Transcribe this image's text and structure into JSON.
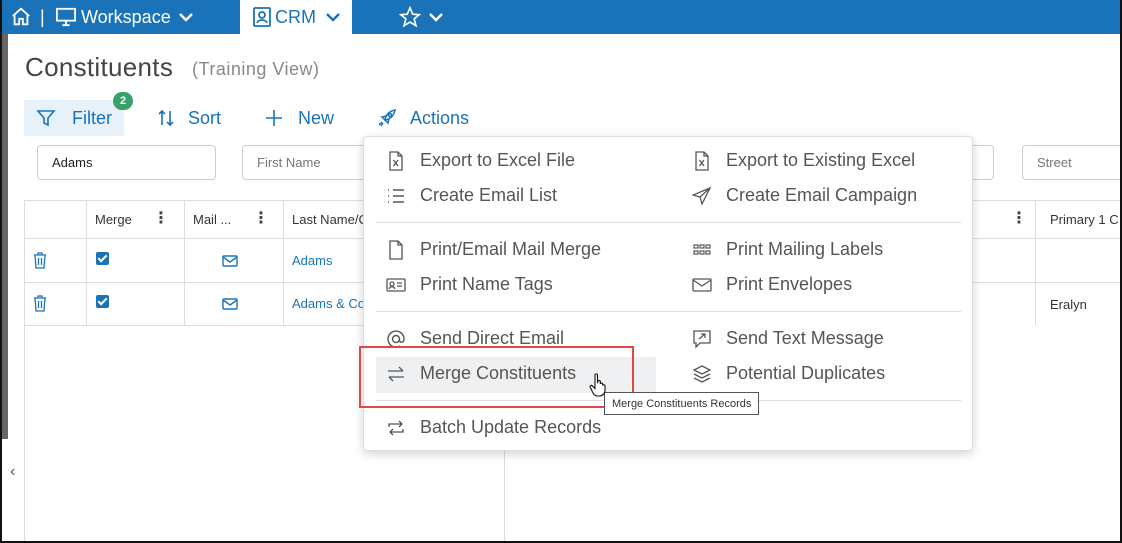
{
  "nav": {
    "separator": "|",
    "workspace_label": "Workspace",
    "crm_label": "CRM"
  },
  "page": {
    "title": "Constituents",
    "subtitle": "(Training View)"
  },
  "toolbar": {
    "filter_label": "Filter",
    "filter_badge": "2",
    "sort_label": "Sort",
    "new_label": "New",
    "actions_label": "Actions"
  },
  "search": {
    "last_name_value": "Adams",
    "first_name_placeholder": "First Name",
    "street_placeholder": "Street"
  },
  "grid": {
    "col_merge": "Merge",
    "col_mail": "Mail ...",
    "col_last_name": "Last Name/C",
    "col_primary": "Primary 1 C",
    "rows": [
      {
        "last_name": "Adams",
        "primary": ""
      },
      {
        "last_name": "Adams & Co",
        "primary": "Eralyn"
      }
    ]
  },
  "actions_menu": {
    "export_excel": "Export to Excel File",
    "export_existing": "Export to Existing Excel",
    "create_email_list": "Create Email List",
    "create_email_campaign": "Create Email Campaign",
    "print_mail_merge": "Print/Email Mail Merge",
    "print_mailing_labels": "Print Mailing Labels",
    "print_name_tags": "Print Name Tags",
    "print_envelopes": "Print Envelopes",
    "send_direct_email": "Send Direct Email",
    "send_text_message": "Send Text Message",
    "merge_constituents": "Merge Constituents",
    "potential_duplicates": "Potential Duplicates",
    "batch_update": "Batch Update Records"
  },
  "tooltip": {
    "text": "Merge Constituents Records"
  },
  "colors": {
    "brand": "#1a73b8",
    "badge": "#37a169",
    "highlight": "#e04848"
  }
}
